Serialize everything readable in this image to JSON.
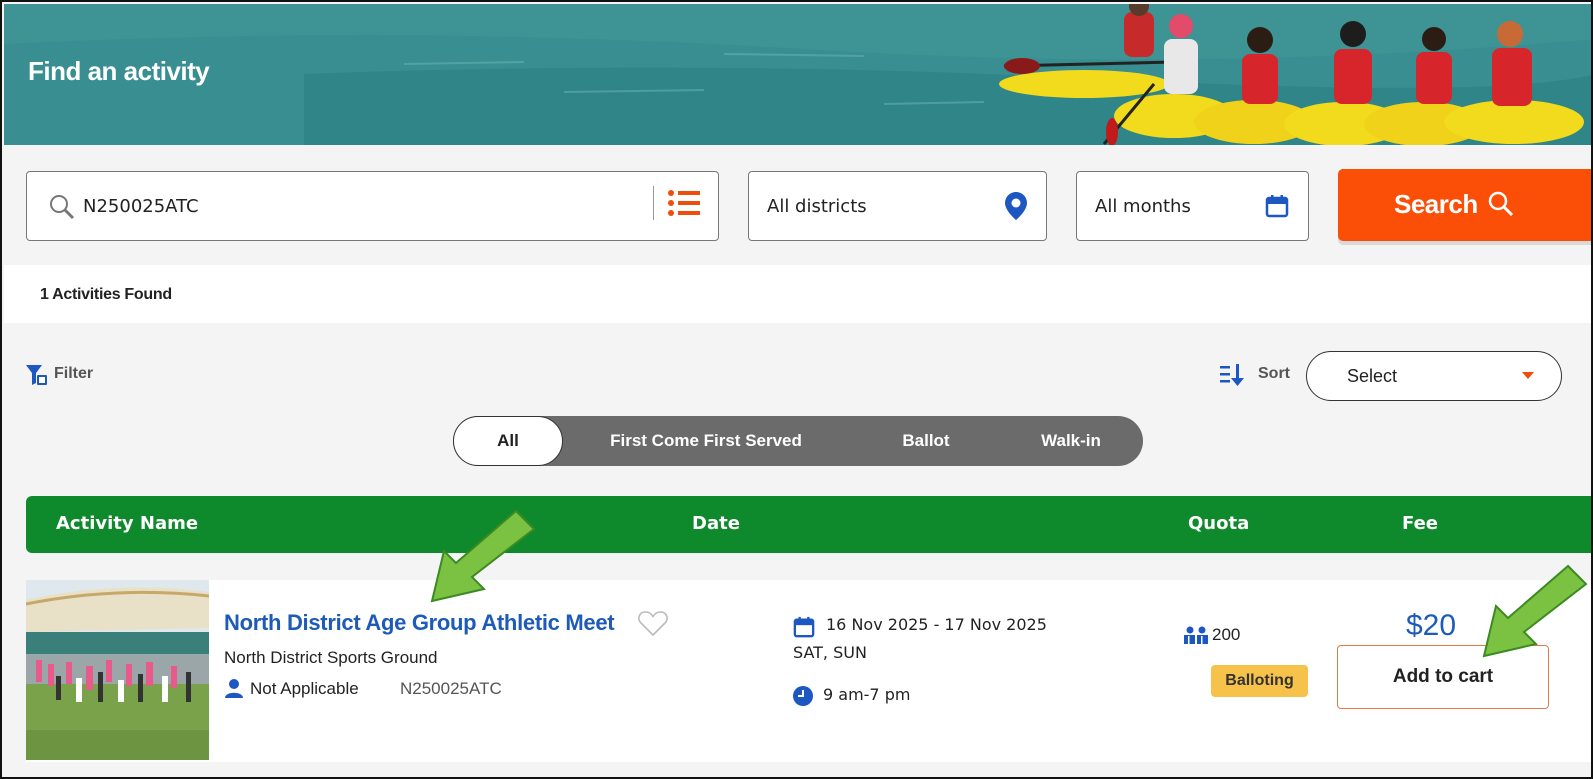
{
  "banner": {
    "title": "Find an activity"
  },
  "search": {
    "keyword_value": "N250025ATC",
    "district_value": "All districts",
    "month_value": "All months",
    "button_label": "Search"
  },
  "results": {
    "count_text": "1 Activities Found"
  },
  "filter": {
    "label": "Filter"
  },
  "sort": {
    "label": "Sort",
    "select_value": "Select"
  },
  "segments": [
    {
      "label": "All",
      "active": true
    },
    {
      "label": "First Come First Served",
      "active": false
    },
    {
      "label": "Ballot",
      "active": false
    },
    {
      "label": "Walk-in",
      "active": false
    }
  ],
  "table": {
    "headers": {
      "name": "Activity Name",
      "date": "Date",
      "quota": "Quota",
      "fee": "Fee"
    },
    "rows": [
      {
        "title": "North District Age Group Athletic Meet",
        "venue": "North District Sports Ground",
        "age": "Not Applicable",
        "code": "N250025ATC",
        "date_range": "16 Nov 2025 - 17 Nov 2025",
        "days": "SAT, SUN",
        "time": "9 am-7 pm",
        "quota": "200",
        "status": "Balloting",
        "fee": "$20",
        "cart_label": "Add to cart"
      }
    ]
  },
  "colors": {
    "banner": "#3f9597",
    "search_button": "#fb4e07",
    "table_header": "#0e8a2d",
    "link": "#1e5bb8",
    "badge": "#f6c24a",
    "arrow": "#7cc242"
  }
}
